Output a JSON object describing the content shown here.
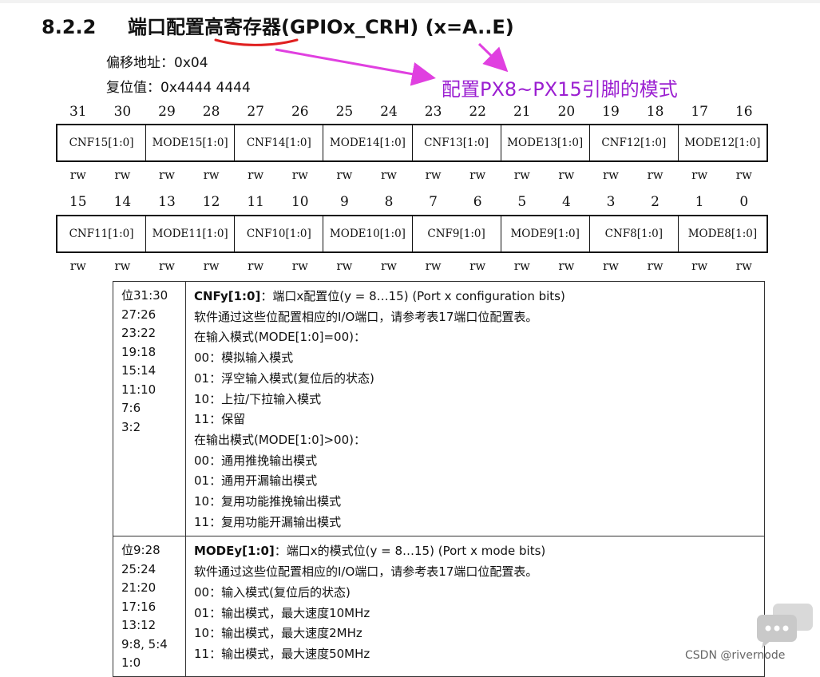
{
  "heading": {
    "number": "8.2.2",
    "title": "端口配置高寄存器(GPIOx_CRH) (x=A..E)"
  },
  "meta": {
    "offset": "偏移地址：0x04",
    "reset": "复位值：0x4444 4444"
  },
  "annotation": "配置PX8~PX15引脚的模式",
  "register": {
    "high_bits": [
      "31",
      "30",
      "29",
      "28",
      "27",
      "26",
      "25",
      "24",
      "23",
      "22",
      "21",
      "20",
      "19",
      "18",
      "17",
      "16"
    ],
    "high_fields": [
      "CNF15[1:0]",
      "MODE15[1:0]",
      "CNF14[1:0]",
      "MODE14[1:0]",
      "CNF13[1:0]",
      "MODE13[1:0]",
      "CNF12[1:0]",
      "MODE12[1:0]"
    ],
    "low_bits": [
      "15",
      "14",
      "13",
      "12",
      "11",
      "10",
      "9",
      "8",
      "7",
      "6",
      "5",
      "4",
      "3",
      "2",
      "1",
      "0"
    ],
    "low_fields": [
      "CNF11[1:0]",
      "MODE11[1:0]",
      "CNF10[1:0]",
      "MODE10[1:0]",
      "CNF9[1:0]",
      "MODE9[1:0]",
      "CNF8[1:0]",
      "MODE8[1:0]"
    ],
    "access": "rw"
  },
  "description": {
    "cnf": {
      "positions": [
        "位31:30",
        "27:26",
        "23:22",
        "19:18",
        "15:14",
        "11:10",
        "7:6",
        "3:2"
      ],
      "title_bold": "CNFy[1:0]",
      "title_rest": "：端口x配置位(y = 8…15) (Port x configuration bits)",
      "lines": [
        "软件通过这些位配置相应的I/O端口，请参考表17端口位配置表。",
        "在输入模式(MODE[1:0]=00)：",
        "00：模拟输入模式",
        "01：浮空输入模式(复位后的状态)",
        "10：上拉/下拉输入模式",
        "11：保留",
        "在输出模式(MODE[1:0]>00)：",
        "00：通用推挽输出模式",
        "01：通用开漏输出模式",
        "10：复用功能推挽输出模式",
        "11：复用功能开漏输出模式"
      ]
    },
    "mode": {
      "positions": [
        "位9:28",
        "25:24",
        "21:20",
        "17:16",
        "13:12",
        "9:8, 5:4",
        "1:0"
      ],
      "title_bold": "MODEy[1:0]",
      "title_rest": "：端口x的模式位(y = 8…15) (Port x mode bits)",
      "lines": [
        "软件通过这些位配置相应的I/O端口，请参考表17端口位配置表。",
        "00：输入模式(复位后的状态)",
        "01：输出模式，最大速度10MHz",
        "10：输出模式，最大速度2MHz",
        "11：输出模式，最大速度50MHz"
      ]
    }
  },
  "watermark": "CSDN @rivernode",
  "colors": {
    "annotation": "#9b1fd1",
    "arrow": "#e040e0",
    "underline": "#e02020"
  }
}
